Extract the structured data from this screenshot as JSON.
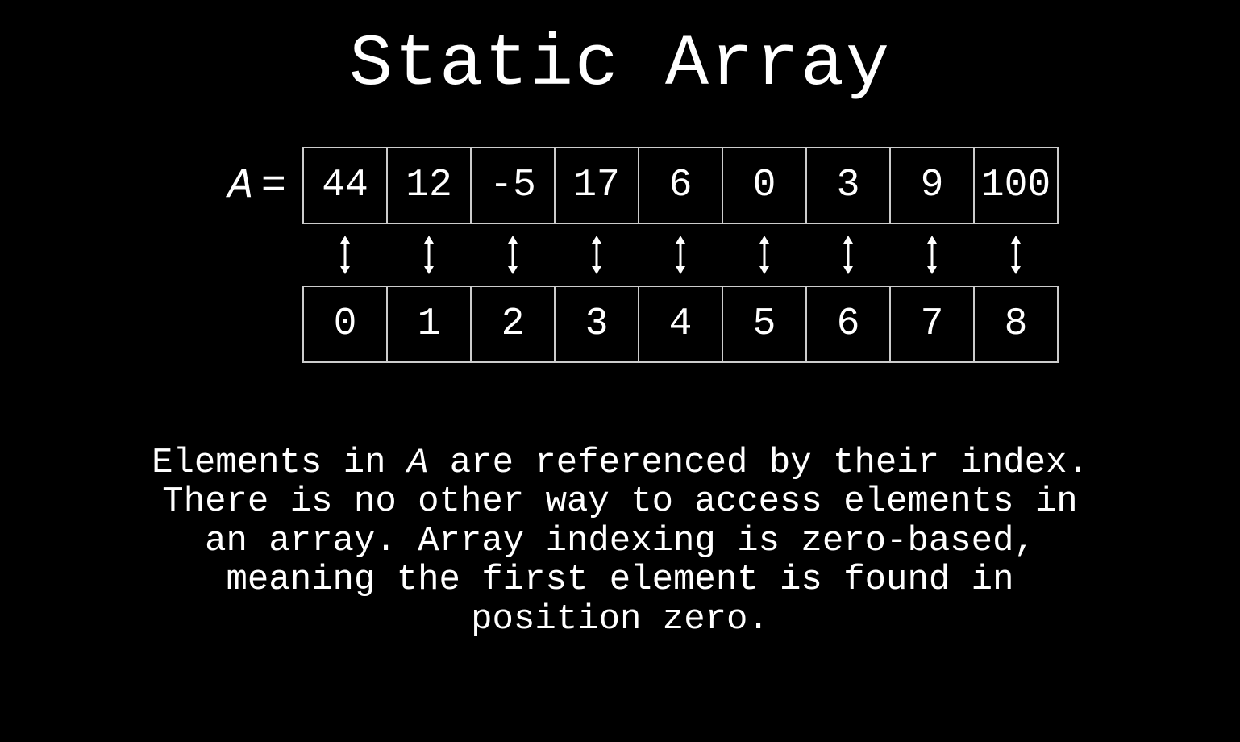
{
  "title": "Static Array",
  "array": {
    "label_var": "A",
    "label_eq": "=",
    "values": [
      "44",
      "12",
      "-5",
      "17",
      "6",
      "0",
      "3",
      "9",
      "100"
    ],
    "indices": [
      "0",
      "1",
      "2",
      "3",
      "4",
      "5",
      "6",
      "7",
      "8"
    ]
  },
  "description": {
    "prefix": "Elements in ",
    "varname": "A",
    "rest": " are referenced by their index. There is no other way to access elements in an array. Array indexing is zero-based, meaning the first element is found in position zero."
  }
}
